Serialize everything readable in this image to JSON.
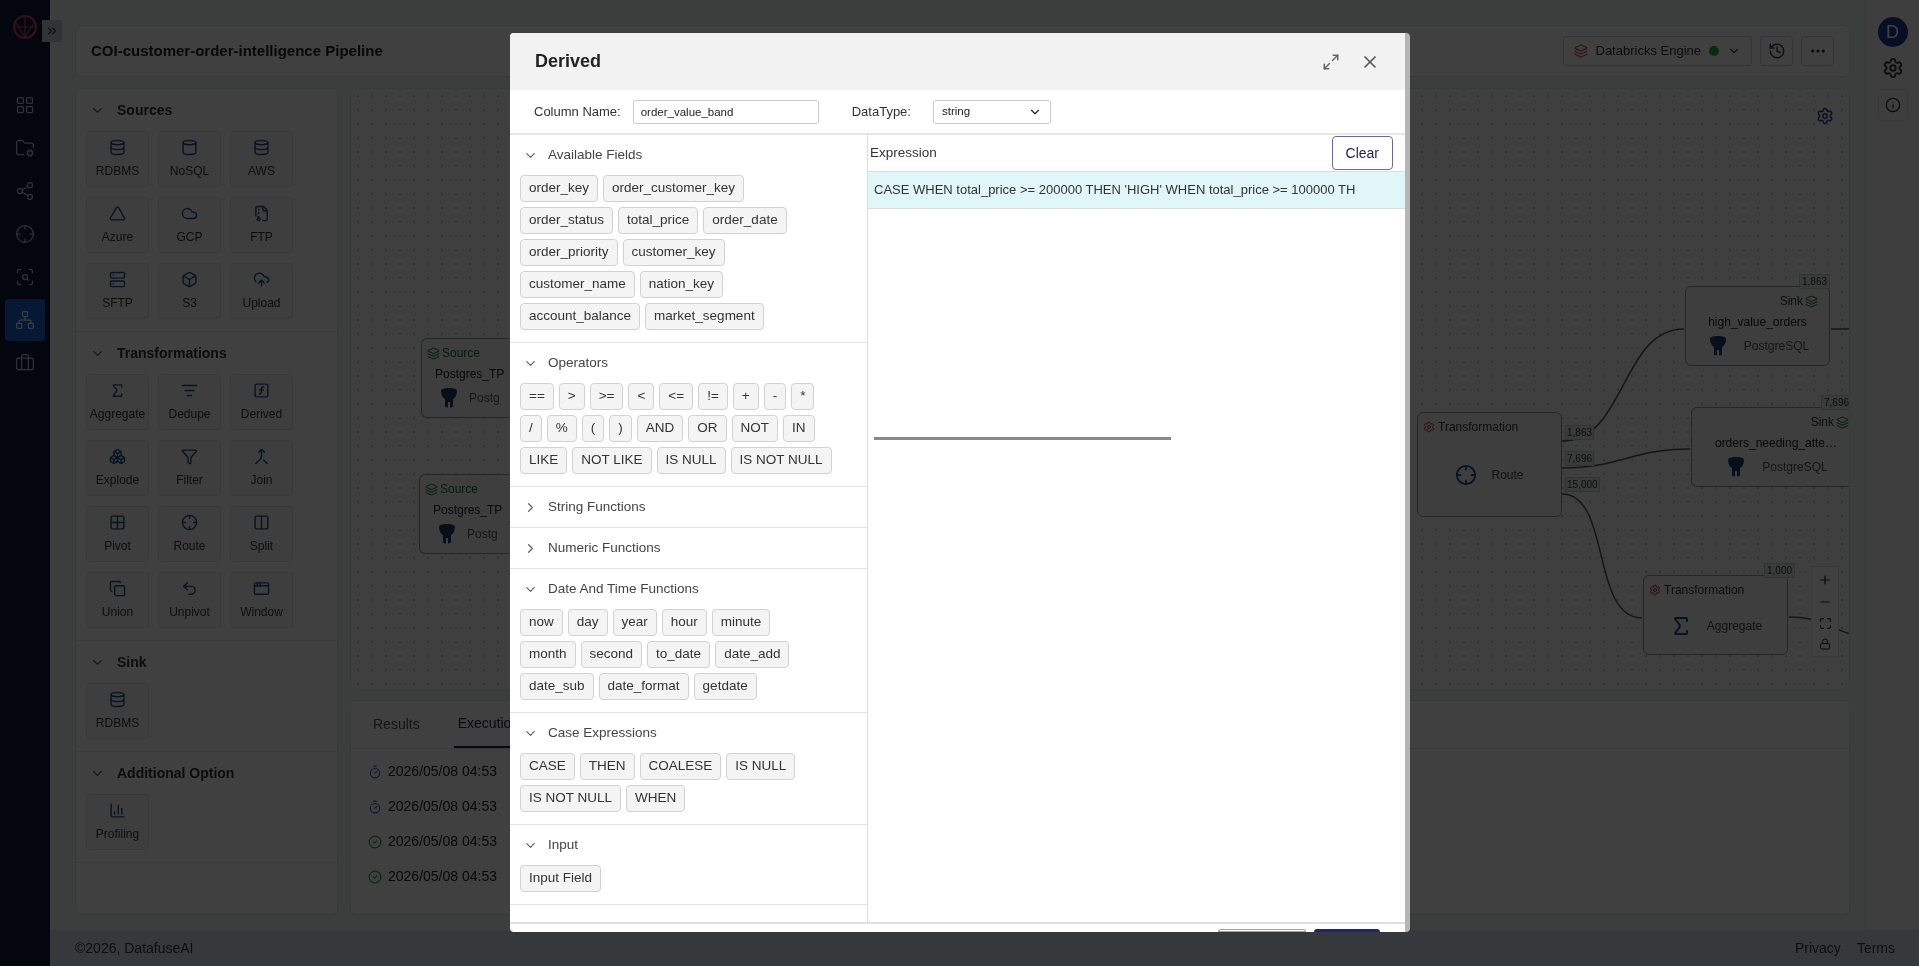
{
  "nav_items": [
    {
      "selected": false
    },
    {
      "selected": false
    },
    {
      "selected": false
    },
    {
      "selected": false
    },
    {
      "selected": false
    },
    {
      "selected": true
    },
    {
      "selected": false
    }
  ],
  "header": {
    "title": "COI-customer-order-intelligence Pipeline",
    "engine": {
      "label": "Databricks Engine",
      "online": true
    }
  },
  "palette": [
    {
      "title": "Sources",
      "expanded": true,
      "items": [
        "RDBMS",
        "NoSQL",
        "AWS",
        "Azure",
        "GCP",
        "FTP",
        "SFTP",
        "S3",
        "Upload"
      ]
    },
    {
      "title": "Transformations",
      "expanded": true,
      "items": [
        "Aggregate",
        "Dedupe",
        "Derived",
        "Explode",
        "Filter",
        "Join",
        "Pivot",
        "Route",
        "Split",
        "Union",
        "Unpivot",
        "Window"
      ]
    },
    {
      "title": "Sink",
      "expanded": true,
      "items": [
        "RDBMS"
      ]
    },
    {
      "title": "Additional Option",
      "expanded": true,
      "items": [
        "Profiling"
      ]
    }
  ],
  "canvas": {
    "nodes": [
      {
        "kind": "source",
        "label": "Source",
        "name": "Postgres_TP",
        "db": "Postg"
      },
      {
        "kind": "source",
        "label": "Source",
        "name": "Postgres_TP",
        "db": "Postg"
      },
      {
        "kind": "transformation",
        "label": "Transformation",
        "name": "Route"
      },
      {
        "kind": "sink",
        "label": "Sink",
        "name": "high_value_orders",
        "db": "PostgreSQL",
        "count": "1,863"
      },
      {
        "kind": "sink",
        "label": "Sink",
        "name": "orders_needing_atte…",
        "db": "PostgreSQL",
        "count": "7,696"
      },
      {
        "kind": "transformation",
        "label": "Transformation",
        "name": "Aggregate",
        "count": "1,000"
      }
    ],
    "route_outputs": [
      "1,863",
      "7,696",
      "15,000"
    ]
  },
  "bottom_panel": {
    "tabs": [
      {
        "label": "Results",
        "selected": false
      },
      {
        "label": "Executio",
        "selected": true
      }
    ],
    "runs": [
      {
        "kind": "running",
        "time": "2026/05/08 04:53"
      },
      {
        "kind": "running",
        "time": "2026/05/08 04:53"
      },
      {
        "kind": "success",
        "time": "2026/05/08 04:53"
      },
      {
        "kind": "success",
        "time": "2026/05/08 04:53"
      }
    ]
  },
  "avatar": "D",
  "footer": {
    "copyright": "©2026, DatafuseAI",
    "links": [
      "Privacy",
      "Terms"
    ]
  },
  "modal": {
    "title": "Derived",
    "column_name": {
      "label": "Column Name:",
      "value": "order_value_band"
    },
    "datatype": {
      "label": "DataType:",
      "value": "string"
    },
    "sections": [
      {
        "title": "Available Fields",
        "expanded": true,
        "chips": [
          "order_key",
          "order_customer_key",
          "order_status",
          "total_price",
          "order_date",
          "order_priority",
          "customer_key",
          "customer_name",
          "nation_key",
          "account_balance",
          "market_segment"
        ]
      },
      {
        "title": "Operators",
        "expanded": true,
        "chips": [
          "==",
          ">",
          ">=",
          "<",
          "<=",
          "!=",
          "+",
          "-",
          "*",
          "/",
          "%",
          "(",
          ")",
          "AND",
          "OR",
          "NOT",
          "IN",
          "LIKE",
          "NOT LIKE",
          "IS NULL",
          "IS NOT NULL"
        ]
      },
      {
        "title": "String Functions",
        "expanded": false
      },
      {
        "title": "Numeric Functions",
        "expanded": false
      },
      {
        "title": "Date And Time Functions",
        "expanded": true,
        "chips": [
          "now",
          "day",
          "year",
          "hour",
          "minute",
          "month",
          "second",
          "to_date",
          "date_add",
          "date_sub",
          "date_format",
          "getdate"
        ]
      },
      {
        "title": "Case Expressions",
        "expanded": true,
        "chips": [
          "CASE",
          "THEN",
          "COALESE",
          "IS NULL",
          "IS NOT NULL",
          "WHEN"
        ]
      },
      {
        "title": "Input",
        "expanded": true,
        "chips": [
          "Input Field"
        ]
      }
    ],
    "expression": {
      "title": "Expression",
      "clear": "Clear",
      "value": "CASE WHEN total_price >= 200000 THEN 'HIGH' WHEN total_price >= 100000 TH"
    }
  }
}
